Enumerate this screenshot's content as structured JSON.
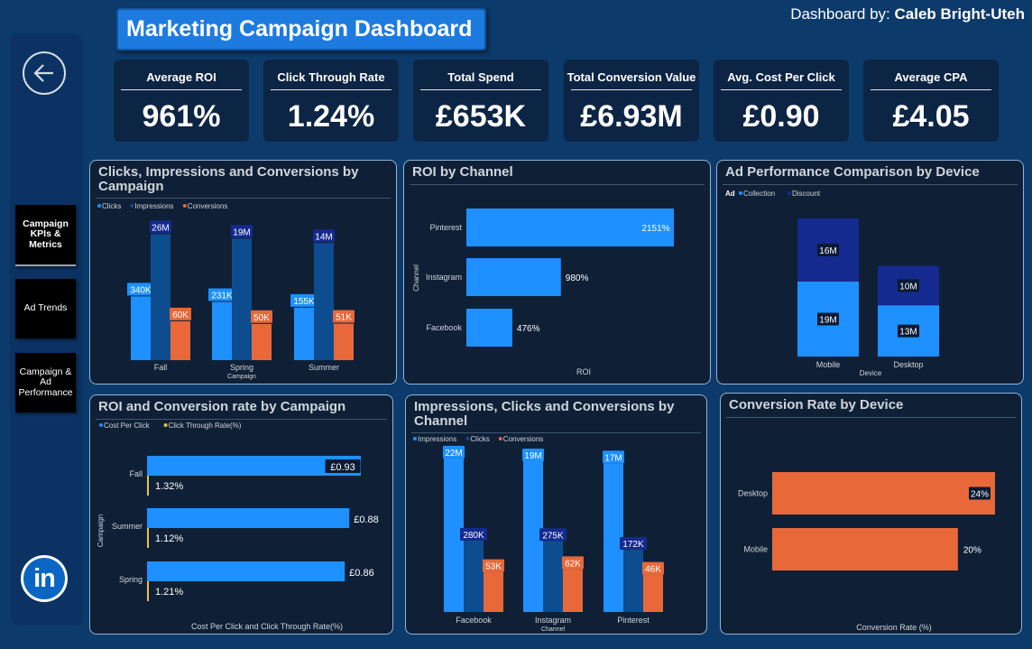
{
  "header": {
    "title": "Marketing Campaign Dashboard",
    "byline_prefix": "Dashboard by:",
    "byline_name": "Caleb Bright-Uteh"
  },
  "sidebar": {
    "back_icon": "arrow-left-circle-icon",
    "items": [
      {
        "label": "Campaign KPIs & Metrics",
        "active": true
      },
      {
        "label": "Ad Trends",
        "active": false
      },
      {
        "label": "Campaign & Ad Performance",
        "active": false
      }
    ],
    "linkedin_text": "in"
  },
  "kpis": [
    {
      "label": "Average ROI",
      "value": "961%"
    },
    {
      "label": "Click Through Rate",
      "value": "1.24%"
    },
    {
      "label": "Total Spend",
      "value": "£653K"
    },
    {
      "label": "Total Conversion Value",
      "value": "£6.93M"
    },
    {
      "label": "Avg. Cost Per Click",
      "value": "£0.90"
    },
    {
      "label": "Average CPA",
      "value": "£4.05"
    }
  ],
  "colors": {
    "blue": "#1e90ff",
    "dark_blue": "#0d4d8f",
    "navy": "#152a8f",
    "orange": "#e8683a",
    "yellow": "#e7c24a",
    "text_dim": "#cfd5dc"
  },
  "chart_data": [
    {
      "id": "clicks-impressions-conversions-by-campaign",
      "type": "bar",
      "title": "Clicks, Impressions and Conversions by Campaign",
      "xlabel": "Campaign",
      "ylabel": "",
      "categories": [
        "Fall",
        "Spring",
        "Summer"
      ],
      "series": [
        {
          "name": "Clicks",
          "values": [
            340000,
            231000,
            155000
          ],
          "labels": [
            "340K",
            "231K",
            "155K"
          ]
        },
        {
          "name": "Impressions",
          "values": [
            26000000,
            19000000,
            14000000
          ],
          "labels": [
            "26M",
            "19M",
            "14M"
          ]
        },
        {
          "name": "Conversions",
          "values": [
            60000,
            50000,
            51000
          ],
          "labels": [
            "60K",
            "50K",
            "51K"
          ]
        }
      ]
    },
    {
      "id": "roi-by-channel",
      "type": "bar",
      "title": "ROI by Channel",
      "xlabel": "ROI",
      "ylabel": "Channel",
      "categories": [
        "Pinterest",
        "Instagram",
        "Facebook"
      ],
      "values": [
        2151,
        980,
        476
      ],
      "labels": [
        "2151%",
        "980%",
        "476%"
      ]
    },
    {
      "id": "ad-performance-by-device",
      "type": "bar",
      "title": "Ad Performance Comparison by Device",
      "xlabel": "Device",
      "legend_title": "Ad",
      "categories": [
        "Mobile",
        "Desktop"
      ],
      "series": [
        {
          "name": "Collection",
          "values": [
            19000000,
            13000000
          ],
          "labels": [
            "19M",
            "13M"
          ]
        },
        {
          "name": "Discount",
          "values": [
            16000000,
            10000000
          ],
          "labels": [
            "16M",
            "10M"
          ]
        }
      ]
    },
    {
      "id": "roi-conversion-by-campaign",
      "type": "bar",
      "title": "ROI and Conversion rate by Campaign",
      "xlabel": "Cost Per Click and Click Through Rate(%)",
      "ylabel": "Campaign",
      "categories": [
        "Fall",
        "Summer",
        "Spring"
      ],
      "series": [
        {
          "name": "Cost Per Click",
          "values": [
            0.93,
            0.88,
            0.86
          ],
          "labels": [
            "£0.93",
            "£0.88",
            "£0.86"
          ]
        },
        {
          "name": "Click Through Rate(%)",
          "values": [
            1.32,
            1.12,
            1.21
          ],
          "labels": [
            "1.32%",
            "1.12%",
            "1.21%"
          ]
        }
      ]
    },
    {
      "id": "impressions-clicks-conversions-by-channel",
      "type": "bar",
      "title": "Impressions, Clicks and Conversions by Channel",
      "xlabel": "Channel",
      "categories": [
        "Facebook",
        "Instagram",
        "Pinterest"
      ],
      "series": [
        {
          "name": "Impressions",
          "values": [
            22000000,
            19000000,
            17000000
          ],
          "labels": [
            "22M",
            "19M",
            "17M"
          ]
        },
        {
          "name": "Clicks",
          "values": [
            280000,
            275000,
            172000
          ],
          "labels": [
            "280K",
            "275K",
            "172K"
          ]
        },
        {
          "name": "Conversions",
          "values": [
            53000,
            62000,
            46000
          ],
          "labels": [
            "53K",
            "62K",
            "46K"
          ]
        }
      ]
    },
    {
      "id": "conversion-rate-by-device",
      "type": "bar",
      "title": "Conversion Rate by Device",
      "xlabel": "Conversion Rate (%)",
      "categories": [
        "Desktop",
        "Mobile"
      ],
      "values": [
        24,
        20
      ],
      "labels": [
        "24%",
        "20%"
      ]
    }
  ]
}
